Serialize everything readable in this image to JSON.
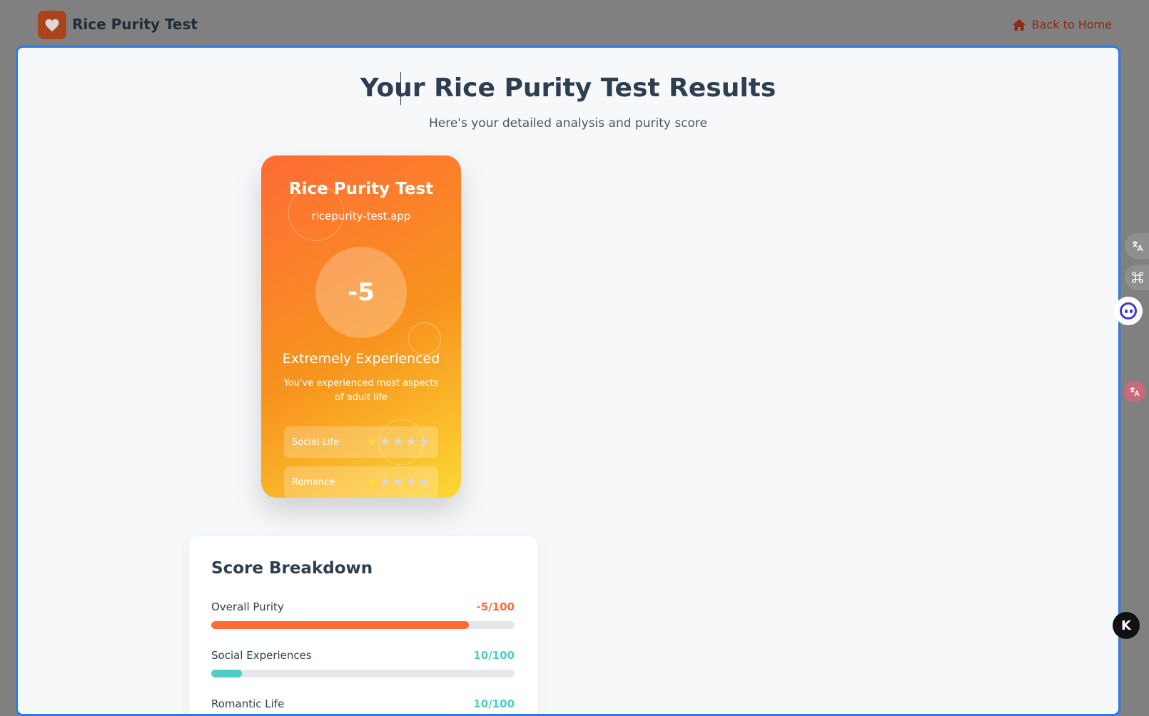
{
  "header": {
    "brand": "Rice Purity Test",
    "back_label": "Back to Home"
  },
  "results": {
    "title": "Your Rice Purity Test Results",
    "subtitle": "Here's your detailed analysis and purity score"
  },
  "card": {
    "title": "Rice Purity Test",
    "url": "ricepurity-test.app",
    "score": "-5",
    "level": "Extremely Experienced",
    "description": "You've experienced most aspects of adult life",
    "ratings": [
      {
        "label": "Social Life",
        "stars": 1,
        "max": 5
      },
      {
        "label": "Romance",
        "stars": 1,
        "max": 5
      }
    ]
  },
  "breakdown": {
    "title": "Score Breakdown",
    "items": [
      {
        "label": "Overall Purity",
        "value": "-5/100",
        "color": "#ff6b35",
        "fill_fraction": 0.85
      },
      {
        "label": "Social Experiences",
        "value": "10/100",
        "color": "#4ecdc4",
        "fill_fraction": 0.1
      },
      {
        "label": "Romantic Life",
        "value": "10/100",
        "color": "#4ecdc4",
        "fill_fraction": 0.1
      }
    ]
  },
  "side_tools": {
    "translate_icon": "translate-icon",
    "apps_icon": "command-icon",
    "assistant_icon": "assistant-face-icon",
    "k_label": "K"
  },
  "colors": {
    "accent_orange": "#ff6b35",
    "accent_teal": "#4ecdc4",
    "modal_border": "#2d7be6",
    "heading": "#2c3e50"
  }
}
